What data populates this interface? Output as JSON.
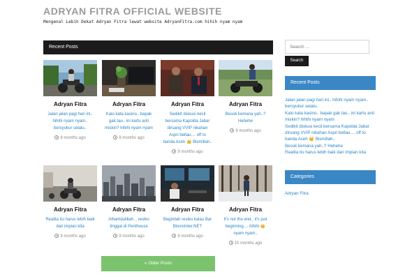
{
  "site": {
    "title": "ADRYAN FITRA OFFICIAL WEBSITE",
    "description": "Mengenal Lebih Dekat Adryan Fitra lewat website AdryanFitra.com hihih nyam nyam"
  },
  "main": {
    "section_title": "Recent Posts",
    "posts": [
      {
        "author": "Adryan Fitra",
        "excerpt": "Jalan jalan pagi hari ini.. hihihi nyam nyam.. bersyukur selalu..",
        "date": "8 months ago"
      },
      {
        "author": "Adryan Fitra",
        "excerpt": "Kalo kata kasino.. bapak gak tau.. ini kartu anti miskin? hihihi nyam nyam",
        "date": "8 months ago"
      },
      {
        "author": "Adryan Fitra",
        "excerpt": "Sedikit diskusi kecil bersama Kapolda Jabar diruang VVIP nikahan Aspri bellau.... off to banda Aceh 👑 Bismillah..",
        "date": "9 months ago"
      },
      {
        "author": "Adryan Fitra",
        "excerpt": "Besok kemana yah..? Hehehe",
        "date": "9 months ago"
      },
      {
        "author": "Adryan Fitra",
        "excerpt": "Realita itu harus lebih baik dari impian kita",
        "date": "9 months ago"
      },
      {
        "author": "Adryan Fitra",
        "excerpt": "Alhamdulillah .. resiko tinggal di Penthouse",
        "date": "9 months ago"
      },
      {
        "author": "Adryan Fitra",
        "excerpt": "Beginilah resiko kalau Bar BisnisInter.NET",
        "date": "9 months ago"
      },
      {
        "author": "Adryan Fitra",
        "excerpt": "It's not the end.. it's just beginning.... hihihi 👑 nyam nyam..",
        "date": "10 months ago"
      }
    ],
    "older_posts_label": "« Older Posts"
  },
  "sidebar": {
    "search_placeholder": "Search ...",
    "search_button": "Search",
    "recent_title": "Recent Posts",
    "recent_items": [
      "Jalan jalan pagi hari ini.. hihihi nyam nyam.. bersyukur selalu..",
      "Kalo kata kasino.. bapak gak tau.. ini kartu anti miskin? hihihi nyam nyam",
      "Sedikit diskusi kecil bersama Kapolda Jabar diruang VVIP nikahan Aspri bellau.... off to banda Aceh 👑 Bismillah..",
      "Besok kemana yah..? Hehehe",
      "Realita itu harus lebih baik dari impian kita"
    ],
    "categories_title": "Categories",
    "categories": [
      "Adryan Fitra"
    ]
  },
  "colors": {
    "accent": "#3a87c5",
    "dark_bar": "#1b1b1b",
    "link": "#2a84c4",
    "older_button": "#7bc36d"
  }
}
